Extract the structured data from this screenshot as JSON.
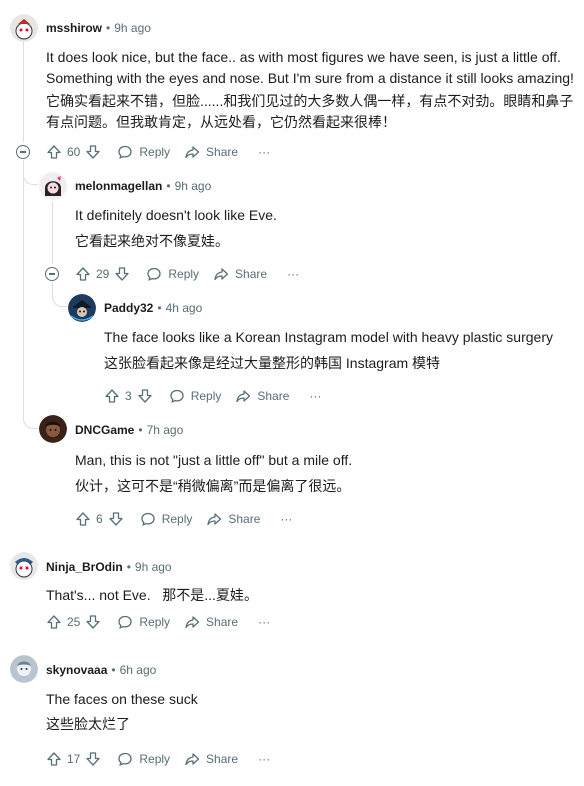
{
  "comments": [
    {
      "user": "msshirow",
      "time": "9h ago",
      "en": "It does look nice, but the face.. as with most figures we have seen, is just a little off. Something with the eyes and nose. But I'm sure from a distance it still looks amazing!",
      "zh": "它确实看起来不错，但脸......和我们见过的大多数人偶一样，有点不对劲。眼睛和鼻子有点问题。但我敢肯定，从远处看，它仍然看起来很棒！",
      "votes": "60"
    },
    {
      "user": "melonmagellan",
      "time": "9h ago",
      "en": "It definitely doesn't look like Eve.",
      "zh": "它看起来绝对不像夏娃。",
      "votes": "29"
    },
    {
      "user": "Paddy32",
      "time": "4h ago",
      "en": "The face looks like a Korean Instagram model with heavy plastic surgery",
      "zh": "这张脸看起来像是经过大量整形的韩国 Instagram 模特",
      "votes": "3"
    },
    {
      "user": "DNCGame",
      "time": "7h ago",
      "en": "Man, this is not \"just a little off\" but a mile off.",
      "zh": "伙计，这可不是“稍微偏离”而是偏离了很远。",
      "votes": "6"
    },
    {
      "user": "Ninja_BrOdin",
      "time": "9h ago",
      "en": "That's... not Eve.   那不是...夏娃。",
      "votes": "25"
    },
    {
      "user": "skynovaaa",
      "time": "6h ago",
      "en": "The faces on these suck",
      "zh": "这些脸太烂了",
      "votes": "17"
    }
  ],
  "labels": {
    "reply": "Reply",
    "share": "Share",
    "more": "···",
    "dot": "•"
  },
  "icons": [
    "upvote-icon",
    "downvote-icon",
    "reply-icon",
    "share-icon",
    "more-icon",
    "collapse-icon"
  ]
}
